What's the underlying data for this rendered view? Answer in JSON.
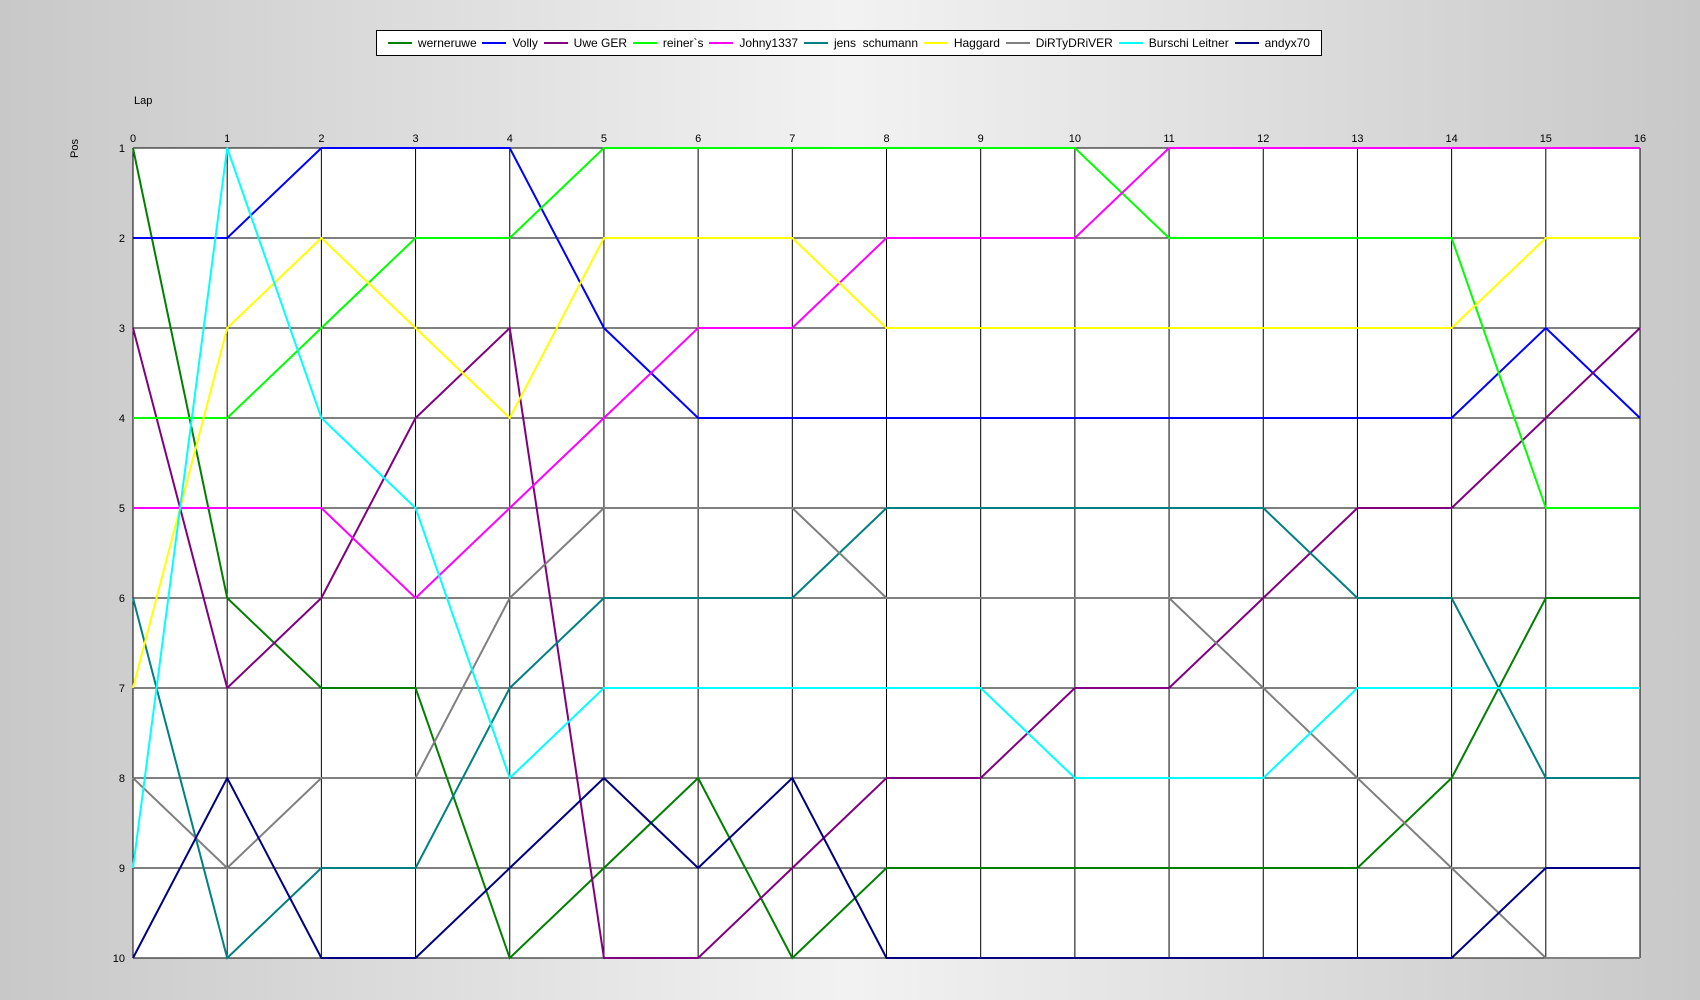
{
  "chart_data": {
    "type": "line",
    "title": "",
    "xlabel": "Lap",
    "ylabel": "Pos",
    "x": [
      0,
      1,
      2,
      3,
      4,
      5,
      6,
      7,
      8,
      9,
      10,
      11,
      12,
      13,
      14,
      15,
      16
    ],
    "xlim": [
      0,
      16
    ],
    "ylim": [
      1,
      10
    ],
    "y_inverted": true,
    "y_ticks": [
      1,
      2,
      3,
      4,
      5,
      6,
      7,
      8,
      9,
      10
    ],
    "grid": true,
    "legend_position": "top",
    "series": [
      {
        "name": "werneruwe",
        "color": "#008000",
        "values": [
          1,
          6,
          7,
          7,
          10,
          9,
          8,
          10,
          9,
          9,
          9,
          9,
          9,
          9,
          8,
          6,
          6
        ]
      },
      {
        "name": "Volly",
        "color": "#0000ff",
        "values": [
          2,
          2,
          1,
          1,
          1,
          3,
          4,
          4,
          4,
          4,
          4,
          4,
          4,
          4,
          4,
          3,
          4
        ]
      },
      {
        "name": "Uwe GER",
        "color": "#800080",
        "values": [
          3,
          7,
          6,
          4,
          3,
          10,
          10,
          9,
          8,
          8,
          7,
          7,
          6,
          5,
          5,
          4,
          3
        ]
      },
      {
        "name": "reiner`s",
        "color": "#00ff00",
        "values": [
          4,
          4,
          3,
          2,
          2,
          1,
          1,
          1,
          1,
          1,
          1,
          2,
          2,
          2,
          2,
          5,
          5
        ]
      },
      {
        "name": "Johny1337",
        "color": "#ff00ff",
        "values": [
          5,
          5,
          5,
          6,
          5,
          4,
          3,
          3,
          2,
          2,
          2,
          1,
          1,
          1,
          1,
          1,
          1
        ]
      },
      {
        "name": "jens  schumann",
        "color": "#008080",
        "values": [
          6,
          10,
          9,
          9,
          7,
          6,
          6,
          6,
          5,
          5,
          5,
          5,
          5,
          6,
          6,
          8,
          8
        ]
      },
      {
        "name": "Haggard",
        "color": "#ffff00",
        "values": [
          7,
          3,
          2,
          3,
          4,
          2,
          2,
          2,
          3,
          3,
          3,
          3,
          3,
          3,
          3,
          2,
          2
        ]
      },
      {
        "name": "DiRTyDRiVER",
        "color": "#808080",
        "values": [
          8,
          9,
          8,
          8,
          6,
          5,
          5,
          5,
          6,
          6,
          6,
          6,
          7,
          8,
          9,
          10,
          10
        ]
      },
      {
        "name": "Burschi Leitner",
        "color": "#00ffff",
        "values": [
          9,
          1,
          4,
          5,
          8,
          7,
          7,
          7,
          7,
          7,
          8,
          8,
          8,
          7,
          7,
          7,
          7
        ]
      },
      {
        "name": "andyx70",
        "color": "#000080",
        "values": [
          10,
          8,
          10,
          10,
          9,
          8,
          9,
          8,
          10,
          10,
          10,
          10,
          10,
          10,
          10,
          9,
          9
        ]
      }
    ]
  }
}
